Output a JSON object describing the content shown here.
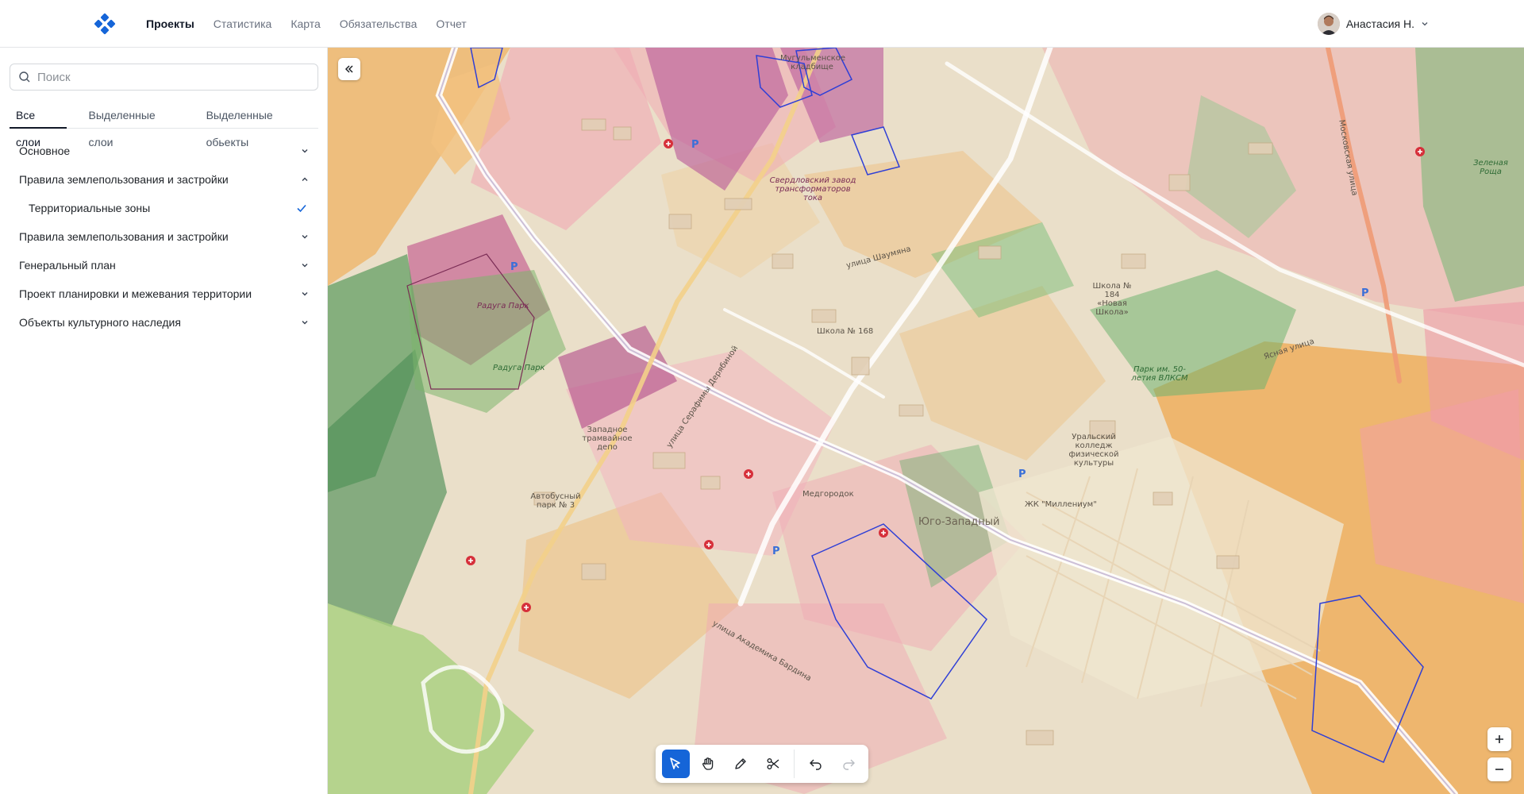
{
  "header": {
    "nav": [
      "Проекты",
      "Статистика",
      "Карта",
      "Обязательства",
      "Отчет"
    ],
    "active_nav": "Проекты",
    "user_name": "Анастасия Н."
  },
  "sidebar": {
    "search_placeholder": "Поиск",
    "tabs": [
      "Все слои",
      "Выделенные слои",
      "Выделенные обьекты"
    ],
    "active_tab": "Все слои",
    "layers": [
      {
        "label": "Основное",
        "state": "collapsed"
      },
      {
        "label": "Правила землепользования и застройки",
        "state": "expanded"
      },
      {
        "label": "Территориальные зоны",
        "state": "checked",
        "sub": true
      },
      {
        "label": "Правила землепользования и застройки",
        "state": "collapsed"
      },
      {
        "label": "Генеральный план",
        "state": "collapsed"
      },
      {
        "label": "Проект планировки и межевания территории",
        "state": "collapsed"
      },
      {
        "label": "Объекты культурного наследия",
        "state": "collapsed"
      }
    ]
  },
  "map": {
    "labels": [
      {
        "text": "Радуга Парк",
        "kind": "purple"
      },
      {
        "text": "Радуга Парк",
        "kind": "green"
      },
      {
        "text": "Западное трамвайное депо",
        "kind": "normal"
      },
      {
        "text": "Автобусный парк № 3",
        "kind": "normal"
      },
      {
        "text": "Медгородок",
        "kind": "normal"
      },
      {
        "text": "Юго-Западный",
        "kind": "big"
      },
      {
        "text": "Школа № 168",
        "kind": "normal"
      },
      {
        "text": "Школа № 184 «Новая Школа»",
        "kind": "normal"
      },
      {
        "text": "Парк им. 50-летия ВЛКСМ",
        "kind": "green"
      },
      {
        "text": "ЖК \"Миллениум\"",
        "kind": "normal"
      },
      {
        "text": "Зеленая Роща",
        "kind": "green"
      },
      {
        "text": "Мугульменское кладбище",
        "kind": "normal"
      },
      {
        "text": "Свердловский завод трансформаторов тока",
        "kind": "purple"
      },
      {
        "text": "Уральский колледж физической культуры",
        "kind": "normal"
      },
      {
        "text": "улица Серафимы Дерябиной",
        "kind": "normal"
      },
      {
        "text": "улица Академика Бардина",
        "kind": "normal"
      },
      {
        "text": "Московская улица",
        "kind": "normal"
      },
      {
        "text": "Ясная улица",
        "kind": "normal"
      },
      {
        "text": "улица Шаумяна",
        "kind": "normal"
      }
    ]
  },
  "toolbar": {
    "tools": [
      "select-tool",
      "pan-tool",
      "draw-tool",
      "cut-tool"
    ],
    "active_tool": "select-tool"
  },
  "colors": {
    "accent": "#1565d8",
    "zone_orange": "#f2b36a",
    "zone_pink": "#f0a6b0",
    "zone_purple": "#b84f8f",
    "zone_green": "#66b36a",
    "zone_blue_outline": "#2f3fd6"
  }
}
